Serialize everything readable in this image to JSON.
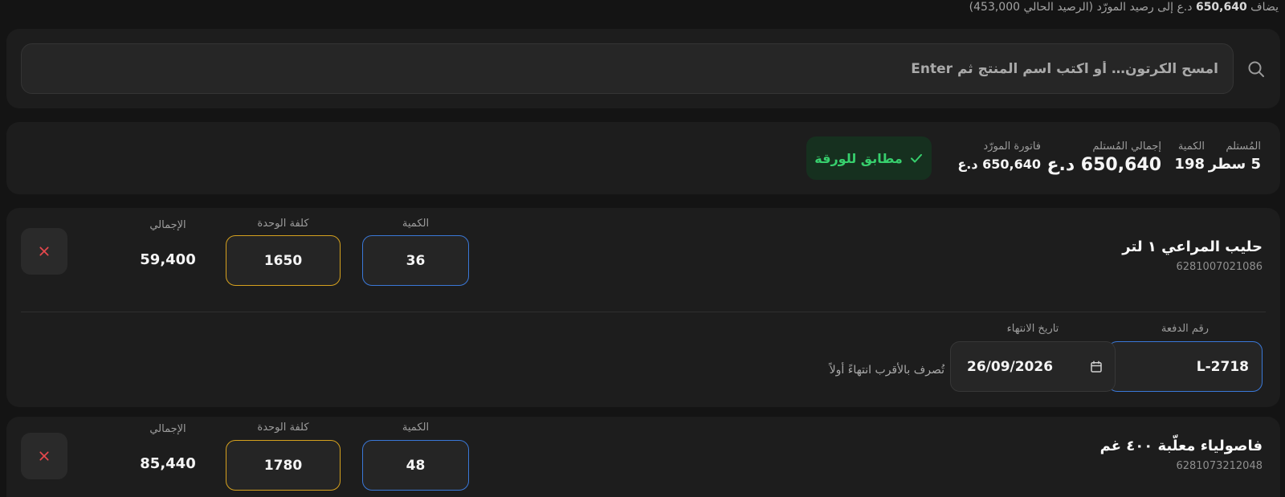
{
  "balance_note": {
    "prefix": "يضاف",
    "amount": "650,640",
    "suffix": "د.ع إلى رصيد المورّد (الرصيد الحالي 453,000)"
  },
  "search": {
    "placeholder": "امسح الكرتون… أو اكتب اسم المنتج ثم Enter"
  },
  "summary": {
    "receiver_label": "المُستلم",
    "receiver_value": "5 سطر",
    "qty_label": "الكمية",
    "qty_value": "198",
    "total_received_label": "إجمالي المُستلم",
    "total_received_value": "650,640 د.ع",
    "supplier_invoice_label": "فاتورة المورّد",
    "supplier_invoice_value": "650,640 د.ع",
    "match_label": "مطابق للورقة"
  },
  "items": [
    {
      "name": "حليب المراعي ١ لتر",
      "code": "6281007021086",
      "qty_label": "الكمية",
      "qty": "36",
      "unit_cost_label": "كلفة الوحدة",
      "unit_cost": "1650",
      "total_label": "الإجمالي",
      "total": "59,400",
      "batch_label": "رقم الدفعة",
      "batch": "L-2718",
      "expiry_label": "تاريخ الانتهاء",
      "expiry": "26/09/2026",
      "fefo_note": "تُصرف بالأقرب انتهاءً أولاً"
    },
    {
      "name": "فاصولياء معلّبة ٤٠٠ غم",
      "code": "6281073212048",
      "qty_label": "الكمية",
      "qty": "48",
      "unit_cost_label": "كلفة الوحدة",
      "unit_cost": "1780",
      "total_label": "الإجمالي",
      "total": "85,440"
    }
  ],
  "colors": {
    "accent_blue": "#3a78d8",
    "accent_yellow": "#d6a11e",
    "success_green": "#37cf6d",
    "danger_red": "#e5484d"
  },
  "icons": {
    "search": "search-icon",
    "check": "check-icon",
    "remove": "close-icon",
    "calendar": "calendar-icon"
  }
}
